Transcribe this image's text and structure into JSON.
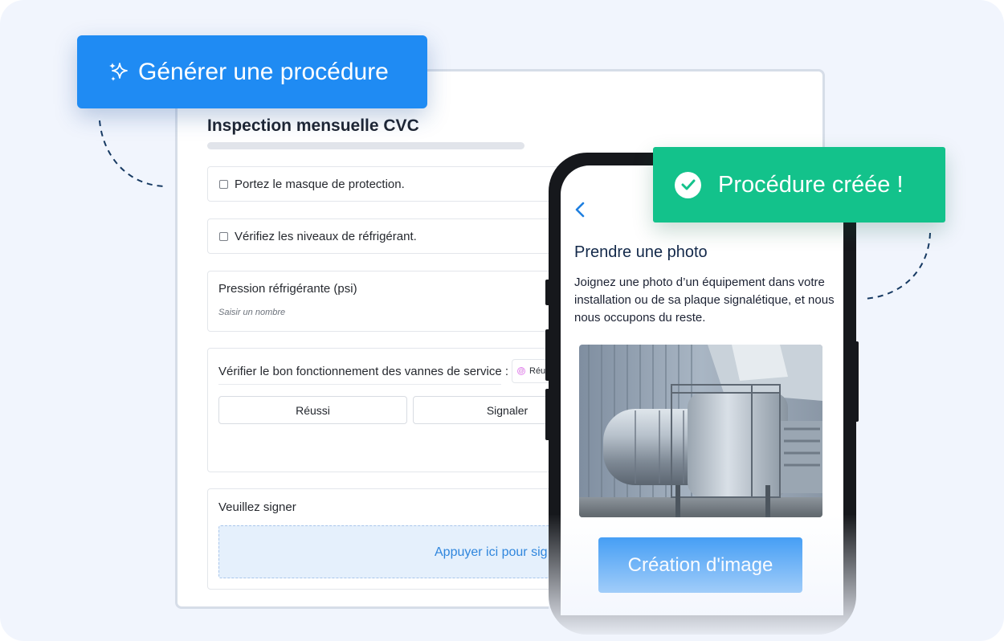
{
  "generate_button": {
    "label": "Générer une procédure",
    "icon": "sparkles-icon",
    "color": "#1f8bf3"
  },
  "form": {
    "title": "Inspection mensuelle CVC",
    "items": [
      {
        "type": "checkbox",
        "label": "Portez le masque de protection.",
        "checked": false
      },
      {
        "type": "checkbox",
        "label": "Vérifiez les niveaux de réfrigérant.",
        "checked": false
      }
    ],
    "pressure": {
      "label": "Pression réfrigérante (psi)",
      "placeholder": "Saisir un nombre"
    },
    "valves": {
      "label": "Vérifier le bon fonctionnement des vannes de service :",
      "tag": "Réu",
      "options": [
        "Réussi",
        "Signaler"
      ]
    },
    "signature": {
      "label": "Veuillez signer",
      "prompt": "Appuyer ici pour sig"
    }
  },
  "success_banner": {
    "label": "Procédure créée !",
    "icon": "check-circle-icon",
    "color": "#13c28b"
  },
  "phone": {
    "back_icon": "chevron-left-icon",
    "title": "Prendre une photo",
    "description": "Joignez une photo d’un équipement dans votre installation ou de sa plaque signalétique, et nous nous occupons du reste.",
    "photo": "hvac-duct-photo",
    "button": "Création d'image"
  }
}
